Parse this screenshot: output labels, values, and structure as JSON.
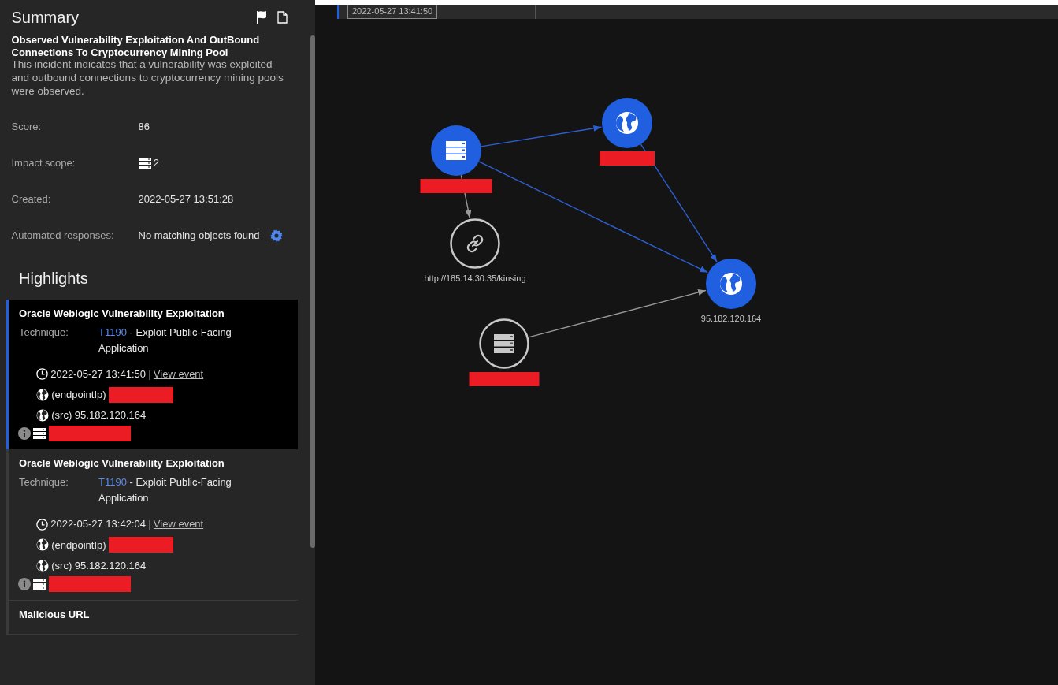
{
  "summary": {
    "title": "Summary",
    "incident_title": "Observed Vulnerability Exploitation And OutBound Connections To Cryptocurrency Mining Pool",
    "description": "This incident indicates that a vulnerability was exploited and outbound connections to cryptocurrency mining pools were observed.",
    "fields": [
      {
        "label": "Score:",
        "value": "86",
        "kind": "text"
      },
      {
        "label": "Impact scope:",
        "value": "2",
        "kind": "hosts"
      },
      {
        "label": "Created:",
        "value": "2022-05-27 13:51:28",
        "kind": "text"
      },
      {
        "label": "Automated responses:",
        "value": "No matching objects found",
        "kind": "settings"
      }
    ]
  },
  "highlights": {
    "title": "Highlights",
    "items": [
      {
        "title": "Oracle Weblogic Vulnerability Exploitation",
        "selected": true,
        "technique_label": "Technique:",
        "technique_id": "T1190",
        "technique_name": "- Exploit Public-Facing Application",
        "time": "2022-05-27 13:41:50",
        "separator": "|",
        "link": "View event",
        "endpoint": "(endpointIp)",
        "src": "(src) 95.182.120.164",
        "host_redacted": true
      },
      {
        "title": "Oracle Weblogic Vulnerability Exploitation",
        "selected": false,
        "technique_label": "Technique:",
        "technique_id": "T1190",
        "technique_name": "- Exploit Public-Facing Application",
        "time": "2022-05-27 13:42:04",
        "separator": "|",
        "link": "View event",
        "endpoint": "(endpointIp)",
        "src": "(src) 95.182.120.164",
        "host_redacted": true
      },
      {
        "title": "Malicious URL",
        "selected": false
      }
    ]
  },
  "timeline": {
    "label": "2022-05-27 13:41:50"
  },
  "graph": {
    "nodes": [
      {
        "kind": "server",
        "highlighted": true,
        "redacted": true
      },
      {
        "kind": "globe",
        "highlighted": true,
        "redacted": true
      },
      {
        "kind": "link",
        "highlighted": false,
        "label": "http://185.14.30.35/kinsing"
      },
      {
        "kind": "globe",
        "highlighted": true,
        "label": "95.182.120.164"
      },
      {
        "kind": "server",
        "highlighted": false,
        "redacted": true
      }
    ],
    "edges": [
      {
        "highlighted": true
      },
      {
        "highlighted": true
      },
      {
        "highlighted": true
      },
      {
        "highlighted": false
      },
      {
        "highlighted": false
      }
    ]
  }
}
